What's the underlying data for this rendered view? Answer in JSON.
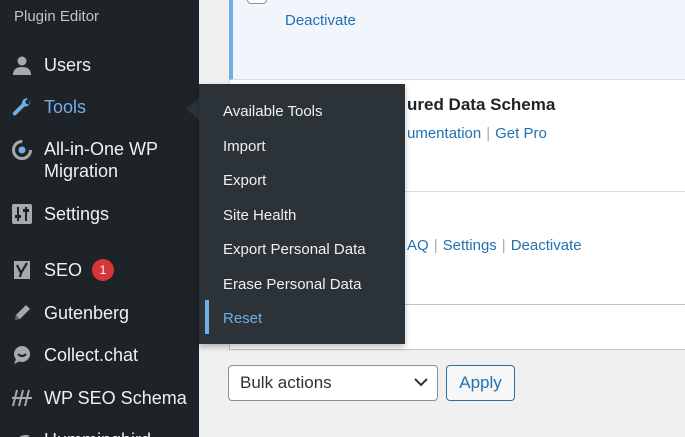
{
  "sidebar": {
    "submenu_label": "Plugin Editor",
    "items": [
      {
        "label": "Users",
        "icon": "users-icon"
      },
      {
        "label": "Tools",
        "icon": "wrench-icon"
      },
      {
        "label": "All-in-One WP",
        "label2": "Migration",
        "icon": "migration-icon"
      },
      {
        "label": "Settings",
        "icon": "settings-sliders-icon"
      },
      {
        "label": "SEO",
        "badge": "1",
        "icon": "yoast-icon"
      },
      {
        "label": "Gutenberg",
        "icon": "pencil-icon"
      },
      {
        "label": "Collect.chat",
        "icon": "chat-bubble-icon"
      },
      {
        "label": "WP SEO Schema",
        "icon": "schema-icon"
      },
      {
        "label": "Hummingbird",
        "icon": "bird-icon"
      }
    ]
  },
  "tools_menu": {
    "items": [
      {
        "label": "Available Tools"
      },
      {
        "label": "Import"
      },
      {
        "label": "Export"
      },
      {
        "label": "Site Health"
      },
      {
        "label": "Export Personal Data"
      },
      {
        "label": "Erase Personal Data"
      },
      {
        "label": "Reset"
      }
    ],
    "current": "Reset"
  },
  "plugins": {
    "row1": {
      "action": "Deactivate"
    },
    "row2": {
      "title_fragment": "ured Data Schema",
      "link1": "umentation",
      "link2": "Get Pro"
    },
    "row3": {
      "link1": "AQ",
      "link2": "Settings",
      "link3": "Deactivate"
    }
  },
  "bulk": {
    "selected": "Bulk actions",
    "apply_label": "Apply"
  },
  "colors": {
    "sidebar_bg": "#1d2327",
    "flyout_bg": "#2c3338",
    "accent": "#72aee6",
    "link": "#2271b1",
    "badge": "#d63638"
  }
}
